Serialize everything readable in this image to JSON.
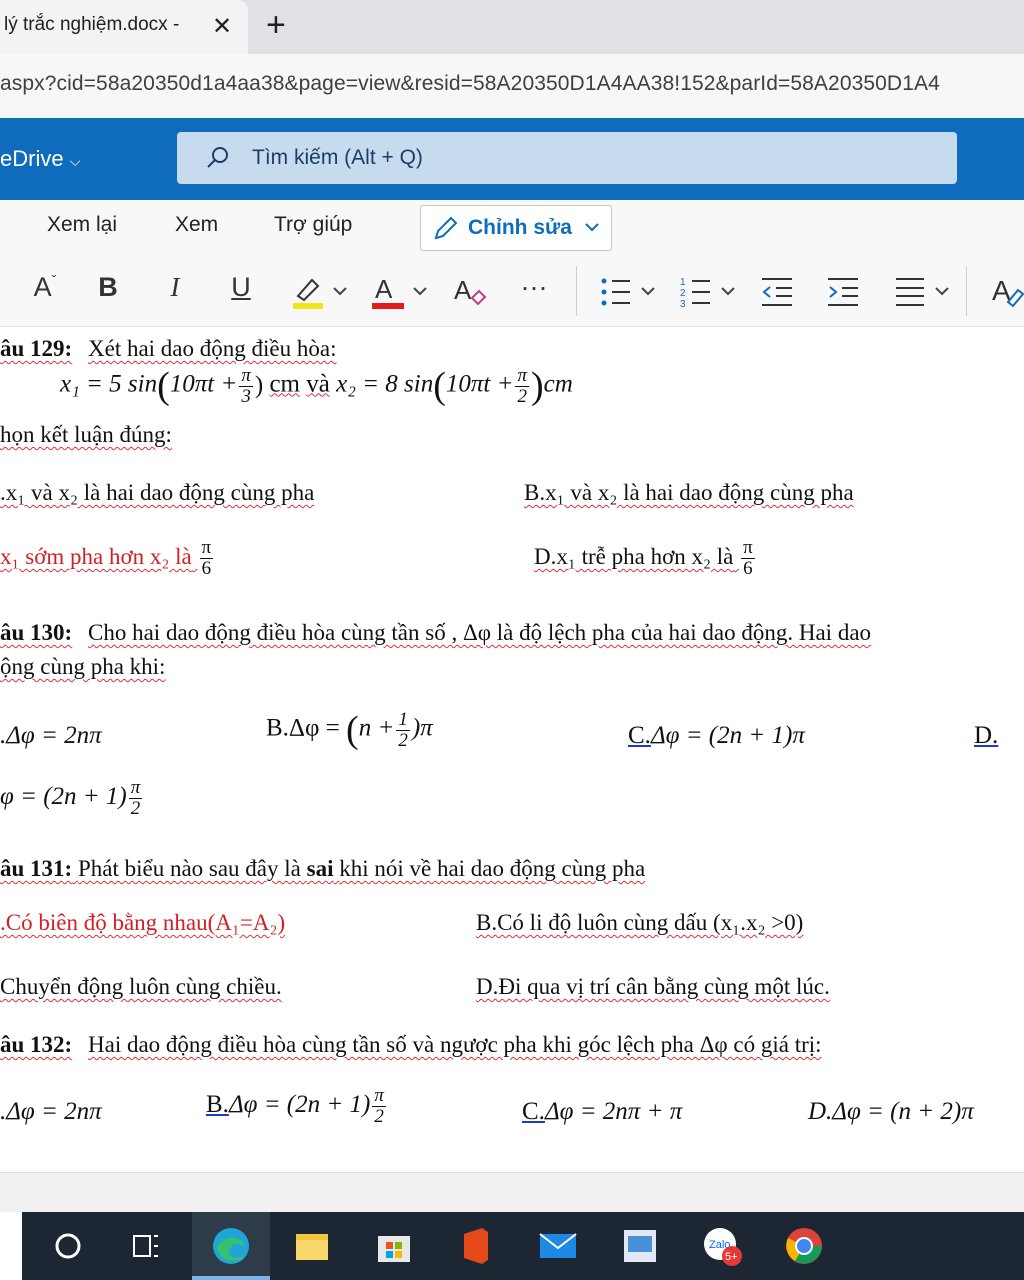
{
  "browser": {
    "tab_title": "lý trắc nghiệm.docx - ",
    "tab_close": "✕",
    "new_tab": "+",
    "url": "aspx?cid=58a20350d1a4aa38&page=view&resid=58A20350D1A4AA38!152&parId=58A20350D1A4"
  },
  "onedrive": {
    "brand": "eDrive",
    "brand_chevron": "⌵",
    "search_placeholder": "Tìm kiếm (Alt + Q)"
  },
  "ribbon": {
    "menu": [
      "Xem lại",
      "Xem",
      "Trợ giúp"
    ],
    "edit_label": "Chỉnh sửa",
    "tools": {
      "font_size": "A",
      "bold": "B",
      "italic": "I",
      "underline": "U",
      "more": "···"
    },
    "highlight_color": "#f3e51c",
    "font_color": "#e01e1e",
    "accent": "#0f6cbd"
  },
  "document": {
    "q129": {
      "label": "âu 129:",
      "text": "Xét hai dao động điều hòa:",
      "eq_x1": "x₁ = 5 sin",
      "eq_arg1": "10πt +",
      "eq_unit1": "cm",
      "eq_va": "và",
      "eq_x2": "x₂ = 8 sin",
      "eq_arg2": "10πt +",
      "eq_unit2": "cm",
      "frac1_num": "π",
      "frac1_den": "3",
      "frac2_num": "π",
      "frac2_den": "2",
      "prompt": "họn kết luận đúng:",
      "optA": ".x₁ và x₂ là hai dao động cùng pha",
      "optB": "B.x₁ và x₂ là hai dao động cùng pha",
      "optC": "x₁ sớm pha hơn x₂ là",
      "optD": "D.x₁ trễ pha hơn x₂ là",
      "frac6_num": "π",
      "frac6_den": "6"
    },
    "q130": {
      "label": "âu 130:",
      "text": "Cho hai dao động điều hòa cùng tần số , Δφ là độ lệch pha của hai dao động. Hai dao",
      "text2": "ộng cùng pha khi:",
      "optA": ".Δφ = 2nπ",
      "optB_pre": "B.Δφ =",
      "optB_mid": "n +",
      "optB_post": ")π",
      "optB_num": "1",
      "optB_den": "2",
      "optC_label": "C.",
      "optC": "Δφ = (2n + 1)π",
      "optD_label": "D.",
      "optD_cont": "φ = (2n + 1)",
      "optD_num": "π",
      "optD_den": "2"
    },
    "q131": {
      "label": "âu 131:",
      "text_pre": "Phát biểu nào sau đây là",
      "text_bold": "sai",
      "text_post": "khi nói về hai dao động cùng pha",
      "optA": ".Có biên độ bằng nhau(A₁=A₂)",
      "optB": "B.Có li độ luôn cùng dấu (x₁.x₂ >0)",
      "optC": "Chuyển động luôn cùng chiều.",
      "optD": "D.Đi qua vị trí cân bằng cùng một lúc."
    },
    "q132": {
      "label": "âu 132:",
      "text": "Hai dao động điều hòa cùng tần số và ngược pha khi góc lệch pha Δφ có giá trị:",
      "optA": ".Δφ = 2nπ",
      "optB_label": "B.",
      "optB": "Δφ = (2n + 1)",
      "optB_num": "π",
      "optB_den": "2",
      "optC_label": "C.",
      "optC": "Δφ = 2nπ + π",
      "optD": "D.Δφ = (n + 2)π"
    }
  },
  "taskbar": {
    "icons": [
      "search-icon",
      "task-view-icon",
      "edge-icon",
      "file-explorer-icon",
      "store-icon",
      "office-icon",
      "mail-icon",
      "image-viewer-icon",
      "zalo-icon",
      "chrome-icon"
    ],
    "zalo_badge": "5+",
    "zalo_text": "Zalo"
  }
}
